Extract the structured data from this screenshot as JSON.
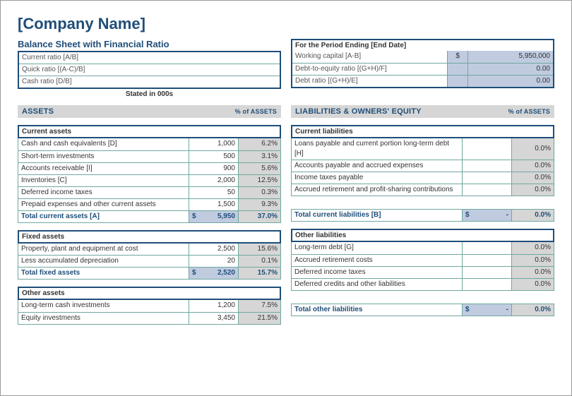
{
  "header": {
    "company": "[Company Name]",
    "subtitle": "Balance Sheet with Financial Ratio"
  },
  "leftRatios": [
    {
      "label": "Current ratio [A/B]",
      "value": ""
    },
    {
      "label": "Quick ratio [(A-C)/B]",
      "value": ""
    },
    {
      "label": "Cash ratio [D/B]",
      "value": ""
    }
  ],
  "statedCaption": "Stated in 000s",
  "periodTitle": "For the Period Ending [End Date]",
  "rightRatios": [
    {
      "label": "Working capital [A-B]",
      "sym": "$",
      "value": "5,950,000"
    },
    {
      "label": "Debt-to-equity ratio [(G+H)/F]",
      "sym": "",
      "value": "0.00"
    },
    {
      "label": "Debt ratio [(G+H)/E]",
      "sym": "",
      "value": "0.00"
    }
  ],
  "assetsBar": {
    "title": "ASSETS",
    "sub": "% of ASSETS"
  },
  "liabBar": {
    "title": "LIABILITIES & OWNERS' EQUITY",
    "sub": "% of ASSETS"
  },
  "currentAssets": {
    "title": "Current assets",
    "rows": [
      {
        "label": "Cash and cash equivalents [D]",
        "value": "1,000",
        "pct": "6.2%"
      },
      {
        "label": "Short-term investments",
        "value": "500",
        "pct": "3.1%"
      },
      {
        "label": "Accounts receivable [I]",
        "value": "900",
        "pct": "5.6%"
      },
      {
        "label": "Inventories [C]",
        "value": "2,000",
        "pct": "12.5%"
      },
      {
        "label": "Deferred income taxes",
        "value": "50",
        "pct": "0.3%"
      },
      {
        "label": "Prepaid expenses and other current assets",
        "value": "1,500",
        "pct": "9.3%"
      }
    ],
    "total": {
      "label": "Total current assets [A]",
      "sym": "$",
      "value": "5,950",
      "pct": "37.0%"
    }
  },
  "fixedAssets": {
    "title": "Fixed assets",
    "rows": [
      {
        "label": "Property, plant and equipment at cost",
        "value": "2,500",
        "pct": "15.6%"
      },
      {
        "label": "Less accumulated depreciation",
        "value": "20",
        "pct": "0.1%"
      }
    ],
    "total": {
      "label": "Total fixed assets",
      "sym": "$",
      "value": "2,520",
      "pct": "15.7%"
    }
  },
  "otherAssets": {
    "title": "Other assets",
    "rows": [
      {
        "label": "Long-term cash investments",
        "value": "1,200",
        "pct": "7.5%"
      },
      {
        "label": "Equity investments",
        "value": "3,450",
        "pct": "21.5%"
      }
    ]
  },
  "currentLiabilities": {
    "title": "Current liabilities",
    "rows": [
      {
        "label": "Loans payable and current portion long-term debt [H]",
        "value": "",
        "pct": "0.0%"
      },
      {
        "label": "Accounts payable and accrued expenses",
        "value": "",
        "pct": "0.0%"
      },
      {
        "label": "Income taxes payable",
        "value": "",
        "pct": "0.0%"
      },
      {
        "label": "Accrued retirement and profit-sharing contributions",
        "value": "",
        "pct": "0.0%"
      }
    ],
    "total": {
      "label": "Total current liabilities [B]",
      "sym": "$",
      "value": "-",
      "pct": "0.0%"
    }
  },
  "otherLiabilities": {
    "title": "Other liabilities",
    "rows": [
      {
        "label": "Long-term debt [G]",
        "value": "",
        "pct": "0.0%"
      },
      {
        "label": "Accrued retirement costs",
        "value": "",
        "pct": "0.0%"
      },
      {
        "label": "Deferred income taxes",
        "value": "",
        "pct": "0.0%"
      },
      {
        "label": "Deferred credits and other liabilities",
        "value": "",
        "pct": "0.0%"
      }
    ],
    "total": {
      "label": "Total other liabilities",
      "sym": "$",
      "value": "-",
      "pct": "0.0%"
    }
  }
}
